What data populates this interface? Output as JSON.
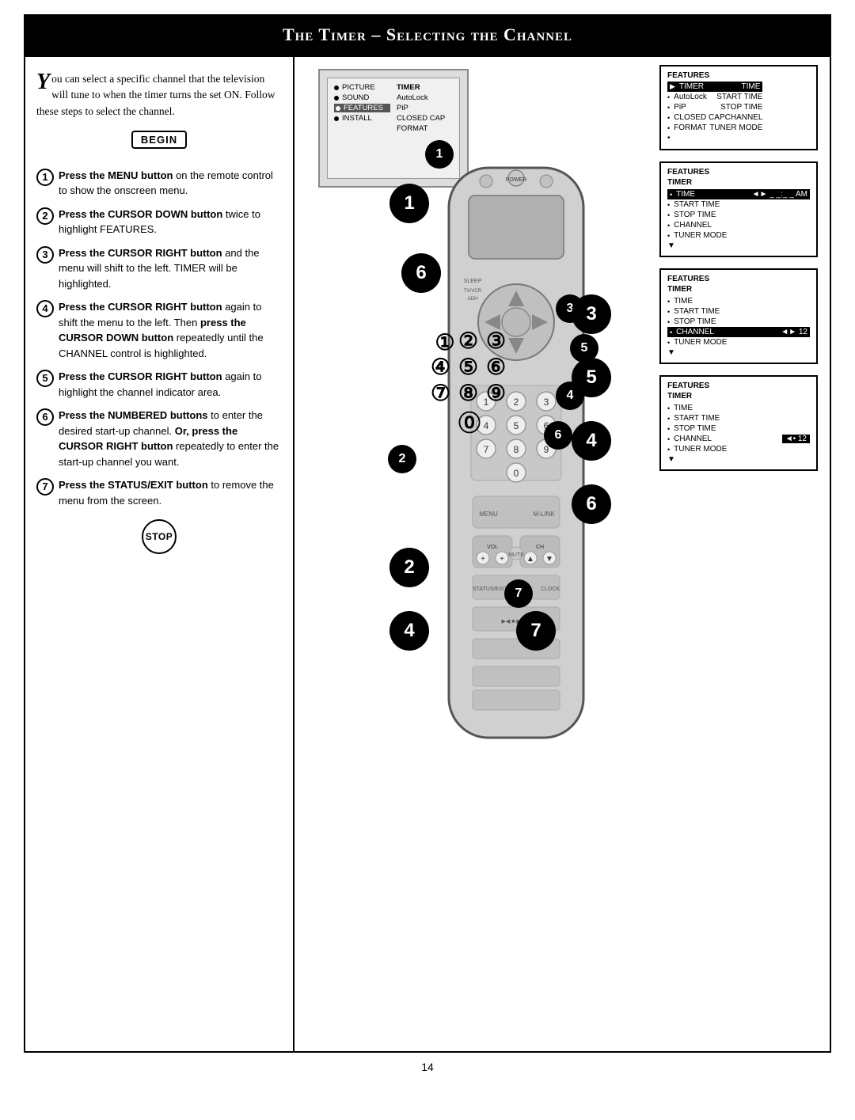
{
  "header": {
    "title": "The Timer – Selecting the Channel"
  },
  "intro": {
    "text": "ou can select a specific channel that the television will tune to when the timer turns the set ON. Follow these steps to select the channel."
  },
  "begin_label": "BEGIN",
  "stop_label": "STOP",
  "steps": [
    {
      "num": "1",
      "text": "Press the MENU button on the remote control to show the onscreen menu."
    },
    {
      "num": "2",
      "text": "Press the CURSOR DOWN button twice to highlight FEATURES."
    },
    {
      "num": "3",
      "text": "Press the CURSOR RIGHT button and the menu will shift to the left. TIMER will be highlighted."
    },
    {
      "num": "4",
      "text": "Press the CURSOR RIGHT button again to shift the menu to the left. Then press the CURSOR DOWN button repeatedly until the CHANNEL control is highlighted."
    },
    {
      "num": "5",
      "text": "Press the CURSOR RIGHT button again to highlight the channel indicator area."
    },
    {
      "num": "6",
      "text": "Press the NUMBERED buttons to enter the desired start-up channel. Or, press the CURSOR RIGHT button repeatedly to enter the start-up channel you want."
    },
    {
      "num": "7",
      "text": "Press the STATUS/EXIT button to remove the menu from the screen."
    }
  ],
  "menus": [
    {
      "id": "menu1",
      "title": "FEATURES",
      "subtitle": "",
      "items": [
        {
          "label": "TIMER",
          "value": "TIME",
          "highlighted": true,
          "bullet": true,
          "arrow": true
        },
        {
          "label": "AutoLock",
          "value": "START TIME",
          "highlighted": false,
          "bullet": true
        },
        {
          "label": "PiP",
          "value": "STOP TIME",
          "highlighted": false,
          "bullet": true
        },
        {
          "label": "CLOSED CAP",
          "value": "CHANNEL",
          "highlighted": false,
          "bullet": true
        },
        {
          "label": "FORMAT",
          "value": "TUNER MODE",
          "highlighted": false,
          "bullet": true
        },
        {
          "label": "•",
          "value": "",
          "highlighted": false,
          "bullet": false
        }
      ]
    },
    {
      "id": "menu2",
      "title": "FEATURES",
      "subtitle": "TIMER",
      "items": [
        {
          "label": "TIME",
          "value": "◄► _ _ : _ _ AM",
          "highlighted": true,
          "bullet": true
        },
        {
          "label": "START TIME",
          "value": "",
          "highlighted": false,
          "bullet": true
        },
        {
          "label": "STOP TIME",
          "value": "",
          "highlighted": false,
          "bullet": true
        },
        {
          "label": "CHANNEL",
          "value": "",
          "highlighted": false,
          "bullet": true
        },
        {
          "label": "TUNER MODE",
          "value": "",
          "highlighted": false,
          "bullet": true
        },
        {
          "label": "▼",
          "value": "",
          "highlighted": false,
          "bullet": false
        }
      ]
    },
    {
      "id": "menu3",
      "title": "FEATURES",
      "subtitle": "TIMER",
      "items": [
        {
          "label": "TIME",
          "value": "",
          "highlighted": false,
          "bullet": true
        },
        {
          "label": "START TIME",
          "value": "",
          "highlighted": false,
          "bullet": true
        },
        {
          "label": "STOP TIME",
          "value": "",
          "highlighted": false,
          "bullet": true
        },
        {
          "label": "CHANNEL",
          "value": "◄► 12",
          "highlighted": true,
          "bullet": true
        },
        {
          "label": "TUNER MODE",
          "value": "",
          "highlighted": false,
          "bullet": true
        },
        {
          "label": "▼",
          "value": "",
          "highlighted": false,
          "bullet": false
        }
      ]
    },
    {
      "id": "menu4",
      "title": "FEATURES",
      "subtitle": "TIMER",
      "items": [
        {
          "label": "TIME",
          "value": "",
          "highlighted": false,
          "bullet": true
        },
        {
          "label": "START TIME",
          "value": "",
          "highlighted": false,
          "bullet": true
        },
        {
          "label": "STOP TIME",
          "value": "",
          "highlighted": false,
          "bullet": true
        },
        {
          "label": "CHANNEL",
          "value": "◄• 12",
          "highlighted": false,
          "bullet": true,
          "val_highlighted": true
        },
        {
          "label": "TUNER MODE",
          "value": "",
          "highlighted": false,
          "bullet": true
        },
        {
          "label": "▼",
          "value": "",
          "highlighted": false,
          "bullet": false
        }
      ]
    }
  ],
  "screenshot": {
    "col1": [
      "PICTURE",
      "SOUND",
      "FEATURES",
      "INSTALL"
    ],
    "col2": [
      "TIMER",
      "AutoLock",
      "PiP",
      "CLOSED CAP",
      "FORMAT"
    ],
    "highlighted_col1": "FEATURES"
  },
  "page_number": "14"
}
